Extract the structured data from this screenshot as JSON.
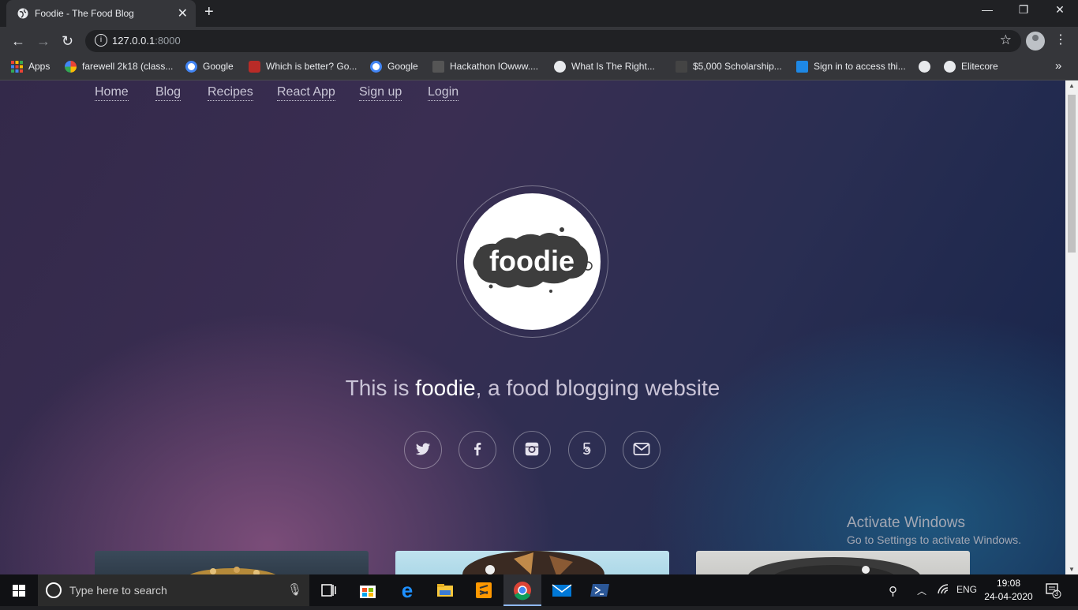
{
  "browser": {
    "tab_title": "Foodie - The Food Blog",
    "tab_close": "✕",
    "new_tab": "+",
    "window_controls": [
      "—",
      "❐",
      "✕"
    ],
    "url_host": "127.0.0.1",
    "url_port": ":8000",
    "bookmarks": [
      {
        "label": "Apps",
        "icon": "apps-grid-icon",
        "color": "#ea4335"
      },
      {
        "label": "farewell 2k18 (class...",
        "icon": "pinwheel-icon",
        "color": "#fbbc05"
      },
      {
        "label": "Google",
        "icon": "google-icon",
        "color": "#4285f4"
      },
      {
        "label": "Which is better? Go...",
        "icon": "quora-icon",
        "color": "#b92b27"
      },
      {
        "label": "Google",
        "icon": "google-icon",
        "color": "#4285f4"
      },
      {
        "label": "Hackathon IOwww....",
        "icon": "hackathon-icon",
        "color": "#555"
      },
      {
        "label": "What Is The Right...",
        "icon": "globe-icon",
        "color": "#e8eaed"
      },
      {
        "label": "$5,000 Scholarship...",
        "icon": "scholarship-icon",
        "color": "#444"
      },
      {
        "label": "Sign in to access thi...",
        "icon": "s-icon",
        "color": "#1e88e5"
      },
      {
        "label": "",
        "icon": "globe-icon",
        "color": "#e8eaed"
      },
      {
        "label": "Elitecore",
        "icon": "globe-icon",
        "color": "#e8eaed"
      }
    ]
  },
  "site": {
    "nav": [
      "Home",
      "Blog",
      "Recipes",
      "React App",
      "Sign up",
      "Login"
    ],
    "logo_text": "foodie",
    "tagline_pre": "This is ",
    "tagline_brand": "foodie",
    "tagline_post": ", a food blogging website",
    "social": [
      "twitter-icon",
      "facebook-icon",
      "instagram-icon",
      "500px-icon",
      "email-icon"
    ]
  },
  "watermark": {
    "line1": "Activate Windows",
    "line2": "Go to Settings to activate Windows."
  },
  "taskbar": {
    "search_placeholder": "Type here to search",
    "apps": [
      "task-view-icon",
      "store-icon",
      "edge-icon",
      "file-explorer-icon",
      "sublime-icon",
      "chrome-icon",
      "mail-icon",
      "powershell-icon"
    ],
    "lang": "ENG",
    "time": "19:08",
    "date": "24-04-2020",
    "notifications": "3"
  },
  "colors": {
    "accent": "#8fb8f0",
    "page_bg_purple": "#3a2e52",
    "page_bg_blue": "#1e5a82"
  }
}
